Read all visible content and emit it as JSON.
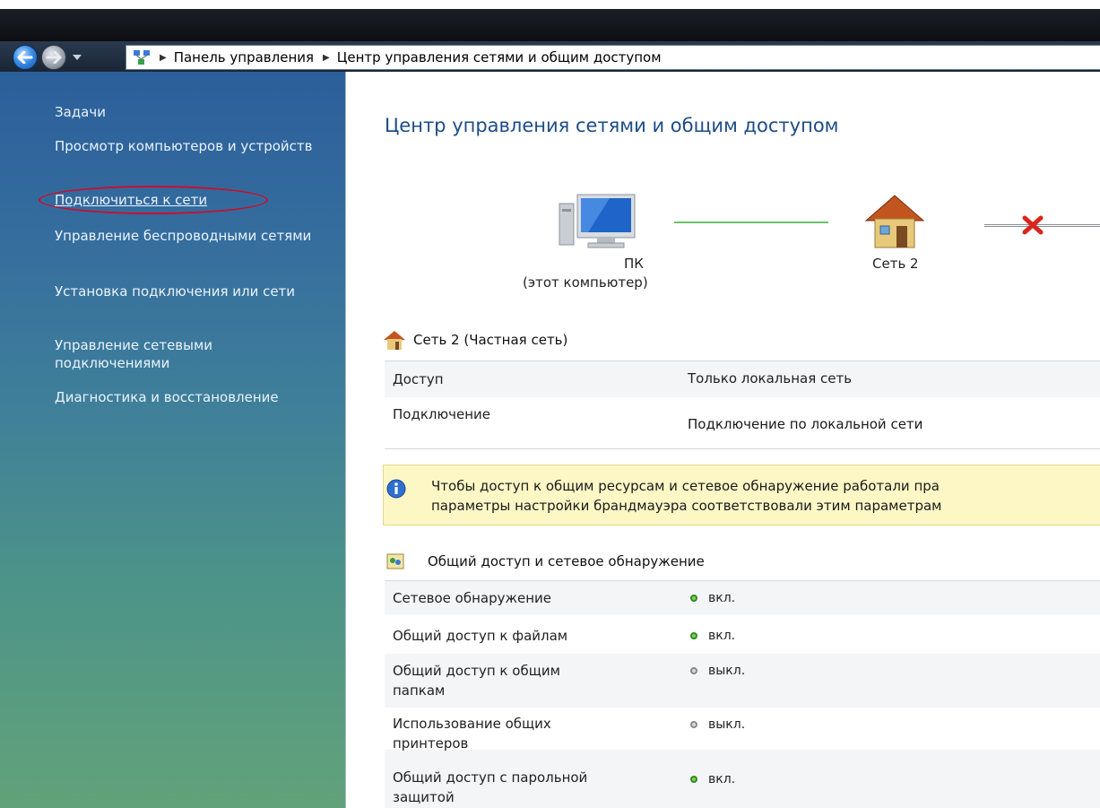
{
  "addressbar": {
    "crumbs": [
      "Панель управления",
      "Центр управления сетями и общим доступом"
    ]
  },
  "sidebar": {
    "title": "Задачи",
    "items": [
      "Просмотр компьютеров и устройств",
      "Подключиться к сети",
      "Управление беспроводными сетями",
      "Установка подключения или сети",
      "Управление сетевыми подключениями",
      "Диагностика и восстановление"
    ]
  },
  "main": {
    "title": "Центр управления сетями и общим доступом",
    "map": {
      "computer_label_line1": "ПК",
      "computer_label_line2": "(этот компьютер)",
      "network_label": "Сеть  2"
    },
    "network": {
      "title": "Сеть  2 (Частная сеть)",
      "rows": [
        {
          "label": "Доступ",
          "value": "Только локальная сеть"
        },
        {
          "label": "Подключение",
          "value": "Подключение по локальной сети"
        }
      ]
    },
    "info": {
      "line1": "Чтобы доступ к общим ресурсам и сетевое обнаружение работали пра",
      "line2": "параметры настройки брандмауэра соответствовали этим параметрам"
    },
    "sharing": {
      "title": "Общий доступ и сетевое обнаружение",
      "rows": [
        {
          "label_line1": "Сетевое обнаружение",
          "label_line2": "",
          "status": "вкл.",
          "state": "on"
        },
        {
          "label_line1": "Общий доступ к файлам",
          "label_line2": "",
          "status": "вкл.",
          "state": "on"
        },
        {
          "label_line1": "Общий доступ к общим",
          "label_line2": "папкам",
          "status": "выкл.",
          "state": "off"
        },
        {
          "label_line1": "Использование общих",
          "label_line2": "принтеров",
          "status": "выкл.",
          "state": "off"
        },
        {
          "label_line1": "Общий доступ с парольной",
          "label_line2": "защитой",
          "status": "вкл.",
          "state": "on"
        }
      ]
    }
  },
  "icons": {
    "back": "back-arrow-icon",
    "forward": "forward-arrow-icon",
    "address": "network-icon",
    "computer": "computer-icon",
    "house": "house-icon",
    "error": "red-x-icon",
    "info": "info-icon",
    "sharing": "sharing-icon"
  },
  "colors": {
    "sidebar_top": "#2b5f9a",
    "sidebar_bottom": "#62a27a",
    "title": "#1d4c88",
    "info_bg": "#fdf7c6",
    "status_on": "#7fd35a",
    "status_off": "#d8d8d8",
    "highlight_ellipse": "#c8102e"
  }
}
